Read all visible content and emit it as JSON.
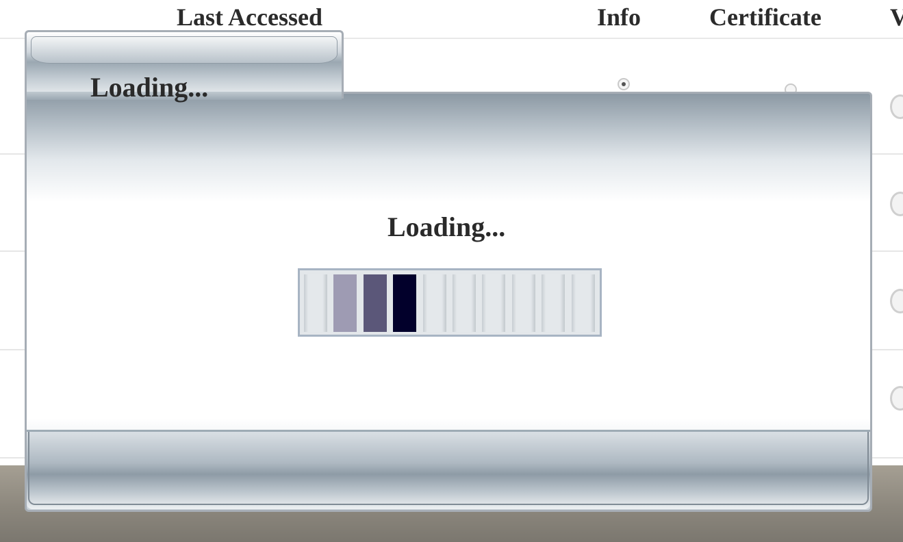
{
  "table": {
    "headers": {
      "last_accessed": "Last Accessed",
      "info": "Info",
      "certificate": "Certificate",
      "truncated": "V"
    }
  },
  "dialog": {
    "tab_title": "Loading...",
    "message": "Loading...",
    "progress": {
      "segments": 10,
      "active_segments": [
        1,
        2,
        3
      ],
      "segment_colors": [
        "#e4e8eb",
        "#9e9bb3",
        "#5b5779",
        "#02002b",
        "#e4e8eb",
        "#e4e8eb",
        "#e4e8eb",
        "#e4e8eb",
        "#e4e8eb",
        "#e4e8eb"
      ]
    }
  },
  "colors": {
    "dialog_border": "#a6adb5",
    "progress_border": "#a7b4c3",
    "overlay_band": "#8c877d"
  }
}
